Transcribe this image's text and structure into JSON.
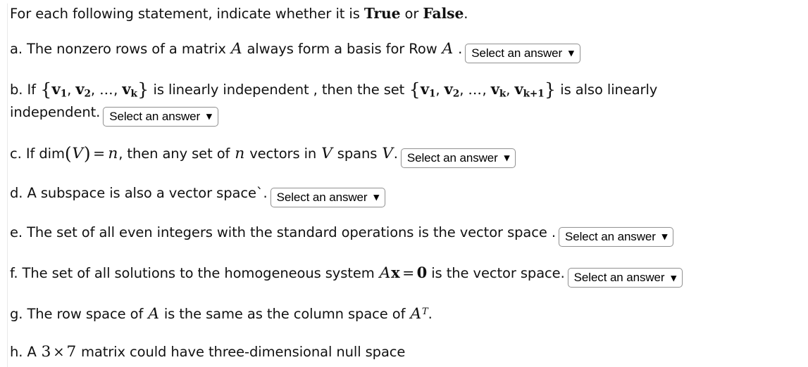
{
  "instructions": {
    "prefix": "For each following statement, indicate whether it is ",
    "true_label": "True",
    "conjunction": " or ",
    "false_label": "False",
    "suffix": "."
  },
  "select": {
    "label": "Select an answer",
    "chevron": "⌄",
    "chevron_icon_name": "chevron-down-icon",
    "options": [
      "Select an answer",
      "True",
      "False"
    ]
  },
  "colors": {
    "page_background": "#ffffff",
    "text": "#111111",
    "select_border": "#949494",
    "left_rule": "#e9e9e9"
  },
  "questions": [
    {
      "id": "a",
      "marker": "a.",
      "has_select": true,
      "parts": [
        {
          "type": "text",
          "value": "The nonzero rows of a matrix "
        },
        {
          "type": "mi",
          "value": "A"
        },
        {
          "type": "text",
          "value": " always form a basis for Row "
        },
        {
          "type": "mi",
          "value": "A"
        },
        {
          "type": "text",
          "value": " ."
        }
      ]
    },
    {
      "id": "b",
      "marker": "b.",
      "has_select": true,
      "parts": [
        {
          "type": "text",
          "value": "If "
        },
        {
          "type": "set",
          "value": "{v1, v2, ..., vk}"
        },
        {
          "type": "text",
          "value": " is linearly independent , then the set "
        },
        {
          "type": "set",
          "value": "{v1, v2, ..., vk, vk+1}"
        },
        {
          "type": "text",
          "value": " is also linearly independent."
        }
      ]
    },
    {
      "id": "c",
      "marker": "c.",
      "has_select": true,
      "parts": [
        {
          "type": "text",
          "value": "If dim"
        },
        {
          "type": "math",
          "value": "(V) = n"
        },
        {
          "type": "text",
          "value": ", then any set of "
        },
        {
          "type": "mi",
          "value": "n"
        },
        {
          "type": "text",
          "value": " vectors in "
        },
        {
          "type": "mi",
          "value": "V"
        },
        {
          "type": "text",
          "value": " spans "
        },
        {
          "type": "mi",
          "value": "V"
        },
        {
          "type": "text",
          "value": "."
        }
      ]
    },
    {
      "id": "d",
      "marker": "d.",
      "has_select": true,
      "parts": [
        {
          "type": "text",
          "value": "A subspace is also a vector space`."
        }
      ]
    },
    {
      "id": "e",
      "marker": "e.",
      "has_select": true,
      "parts": [
        {
          "type": "text",
          "value": "The set of all even integers with the standard operations is the vector space ."
        }
      ]
    },
    {
      "id": "f",
      "marker": "f.",
      "has_select": true,
      "parts": [
        {
          "type": "text",
          "value": "The set of all solutions to the homogeneous system "
        },
        {
          "type": "math",
          "value": "Ax = 0"
        },
        {
          "type": "text",
          "value": " is the vector space."
        }
      ]
    },
    {
      "id": "g",
      "marker": "g.",
      "has_select": false,
      "parts": [
        {
          "type": "text",
          "value": "The row space of "
        },
        {
          "type": "mi",
          "value": "A"
        },
        {
          "type": "text",
          "value": " is the same as the column space of "
        },
        {
          "type": "math",
          "value": "A^T"
        },
        {
          "type": "text",
          "value": "."
        }
      ]
    },
    {
      "id": "h",
      "marker": "h.",
      "has_select": false,
      "parts": [
        {
          "type": "text",
          "value": "A "
        },
        {
          "type": "math",
          "value": "3 x 7"
        },
        {
          "type": "text",
          "value": " matrix could have three-dimensional null space"
        }
      ]
    }
  ],
  "text": {
    "head_prefix": "For each following statement, indicate whether it is ",
    "head_true": "True",
    "head_or": " or ",
    "head_false": "False",
    "head_period": ".",
    "a_marker": "a.",
    "a_t1": " The nonzero rows of a matrix ",
    "a_m1": "A",
    "a_t2": " always form a basis for Row ",
    "a_m2": "A",
    "a_t3": " .",
    "b_marker": "b.",
    "b_t1": " If ",
    "b_t2": " is linearly independent , then the set ",
    "b_t3": " is also linearly",
    "b_t4": "independent.",
    "b_v": "v",
    "b_sub1": "1",
    "b_sub2": "2",
    "b_subk": "k",
    "b_subk1": "k+1",
    "b_dots": "…",
    "b_comma": ",",
    "b_lbrace": "{",
    "b_rbrace": "}",
    "c_marker": "c.",
    "c_t1": " If dim",
    "c_lpar": "(",
    "c_V": "V",
    "c_rpar": ")",
    "c_eq": "=",
    "c_n": "n",
    "c_t2": ", then any set of ",
    "c_n2": "n",
    "c_t3": " vectors in ",
    "c_V2": "V",
    "c_t4": " spans ",
    "c_V3": "V",
    "c_t5": ".",
    "d_marker": "d.",
    "d_t1": " A subspace is also a vector space`.",
    "e_marker": "e.",
    "e_t1": " The set of all even integers with the standard operations is the vector space .",
    "f_marker": "f.",
    "f_t1": " The set of all solutions to the homogeneous system ",
    "f_A": "A",
    "f_x": "x",
    "f_eq": "=",
    "f_0": "0",
    "f_t2": " is the vector space.",
    "g_marker": "g.",
    "g_t1": " The row space of ",
    "g_A": "A",
    "g_t2": " is the same as the column space of ",
    "g_A2": "A",
    "g_T": "T",
    "g_t3": ".",
    "h_marker": "h.",
    "h_t1": " A ",
    "h_3": "3",
    "h_times": "×",
    "h_7": "7",
    "h_t2": " matrix could have three-dimensional null space"
  }
}
